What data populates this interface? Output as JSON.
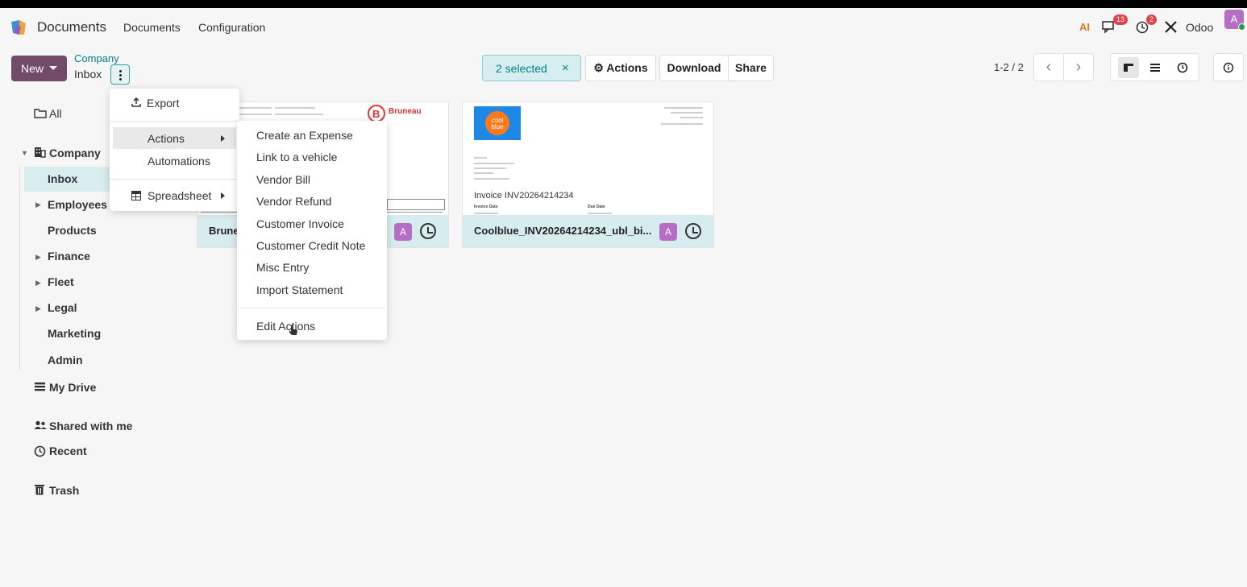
{
  "navbar": {
    "app_name": "Documents",
    "menu": [
      "Documents",
      "Configuration"
    ],
    "ai_label": "AI",
    "messages_count": "13",
    "activities_count": "2",
    "company": "Odoo",
    "avatar_letter": "A"
  },
  "controlpanel": {
    "new_label": "New",
    "breadcrumb_parent": "Company",
    "breadcrumb_current": "Inbox",
    "selected_label": "2 selected",
    "clear_selection": "×",
    "actions_label": "Actions",
    "download_label": "Download",
    "share_label": "Share",
    "pager": "1-2 / 2"
  },
  "sidebar": {
    "all": "All",
    "company": "Company",
    "children": [
      "Inbox",
      "Employees -",
      "Products",
      "Finance",
      "Fleet",
      "Legal",
      "Marketing",
      "Admin"
    ],
    "my_drive": "My Drive",
    "shared": "Shared with me",
    "recent": "Recent",
    "trash": "Trash"
  },
  "cards": [
    {
      "title": "Brune",
      "avatar": "A",
      "vendor": "Bruneau",
      "preview_title": ""
    },
    {
      "title": "Coolblue_INV20264214234_ubl_bi...",
      "avatar": "A",
      "vendor": "cool blue",
      "preview_title": "Invoice INV20264214234",
      "preview_labels": [
        "Invoice Date",
        "Due Date"
      ]
    }
  ],
  "gear_menu": {
    "export": "Export",
    "actions": "Actions",
    "automations": "Automations",
    "spreadsheet": "Spreadsheet"
  },
  "actions_submenu": {
    "items": [
      "Create an Expense",
      "Link to a vehicle",
      "Vendor Bill",
      "Vendor Refund",
      "Customer Invoice",
      "Customer Credit Note",
      "Misc Entry",
      "Import Statement"
    ],
    "edit": "Edit Actions"
  },
  "colors": {
    "brand": "#714b67",
    "accent": "#017e84",
    "selected_bg": "#d9ecee",
    "badge": "#e0414b"
  }
}
